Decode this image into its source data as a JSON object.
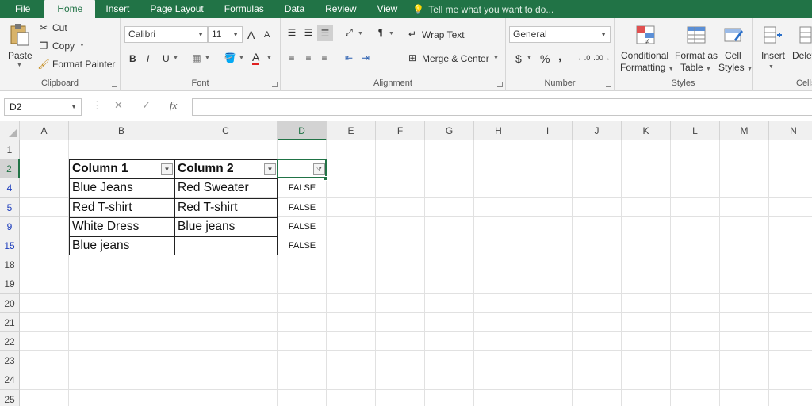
{
  "ribbon_tabs": [
    "File",
    "Home",
    "Insert",
    "Page Layout",
    "Formulas",
    "Data",
    "Review",
    "View"
  ],
  "active_tab": "Home",
  "tell_me": "Tell me what you want to do...",
  "clipboard": {
    "paste": "Paste",
    "cut": "Cut",
    "copy": "Copy",
    "format_painter": "Format Painter",
    "label": "Clipboard"
  },
  "font": {
    "name": "Calibri",
    "size": "11",
    "bold": "B",
    "italic": "I",
    "underline": "U",
    "grow": "A",
    "shrink": "A",
    "font_color": "A",
    "label": "Font"
  },
  "alignment": {
    "wrap_text": "Wrap Text",
    "merge_center": "Merge & Center",
    "label": "Alignment"
  },
  "number": {
    "format": "General",
    "currency": "$",
    "percent": "%",
    "comma": ",",
    "label": "Number"
  },
  "styles": {
    "conditional": "Conditional",
    "formatting": "Formatting",
    "format_as": "Format as",
    "table": "Table",
    "cell": "Cell",
    "cell_styles": "Styles",
    "label": "Styles"
  },
  "cells": {
    "insert": "Insert",
    "delete": "Delet",
    "label": "Cells"
  },
  "formula_bar": {
    "name_box": "D2",
    "fx": "fx",
    "cancel": "✕",
    "enter": "✓",
    "value": ""
  },
  "columns": [
    "A",
    "B",
    "C",
    "D",
    "E",
    "F",
    "G",
    "H",
    "I",
    "J",
    "K",
    "L",
    "M",
    "N"
  ],
  "selected_column": "D",
  "rows": [
    {
      "num": "1",
      "cells": {
        "B": "",
        "C": "",
        "D": ""
      }
    },
    {
      "num": "2",
      "cells": {
        "B": "Column 1",
        "C": "Column 2",
        "D": ""
      }
    },
    {
      "num": "4",
      "cells": {
        "B": "Blue Jeans",
        "C": "Red Sweater",
        "D": "FALSE"
      }
    },
    {
      "num": "5",
      "cells": {
        "B": "Red T-shirt",
        "C": "Red T-shirt",
        "D": "FALSE"
      }
    },
    {
      "num": "9",
      "cells": {
        "B": "White Dress",
        "C": "Blue jeans",
        "D": "FALSE"
      }
    },
    {
      "num": "15",
      "cells": {
        "B": "Blue jeans",
        "C": "",
        "D": "FALSE"
      }
    },
    {
      "num": "18",
      "cells": {}
    },
    {
      "num": "19",
      "cells": {}
    },
    {
      "num": "20",
      "cells": {}
    },
    {
      "num": "21",
      "cells": {}
    },
    {
      "num": "22",
      "cells": {}
    },
    {
      "num": "23",
      "cells": {}
    },
    {
      "num": "24",
      "cells": {}
    },
    {
      "num": "25",
      "cells": {}
    }
  ],
  "selected_row": "2",
  "filtered_rows": [
    "4",
    "5",
    "9",
    "15"
  ],
  "colors": {
    "brand": "#217346",
    "filtered_row_number": "#1f3fbd"
  }
}
